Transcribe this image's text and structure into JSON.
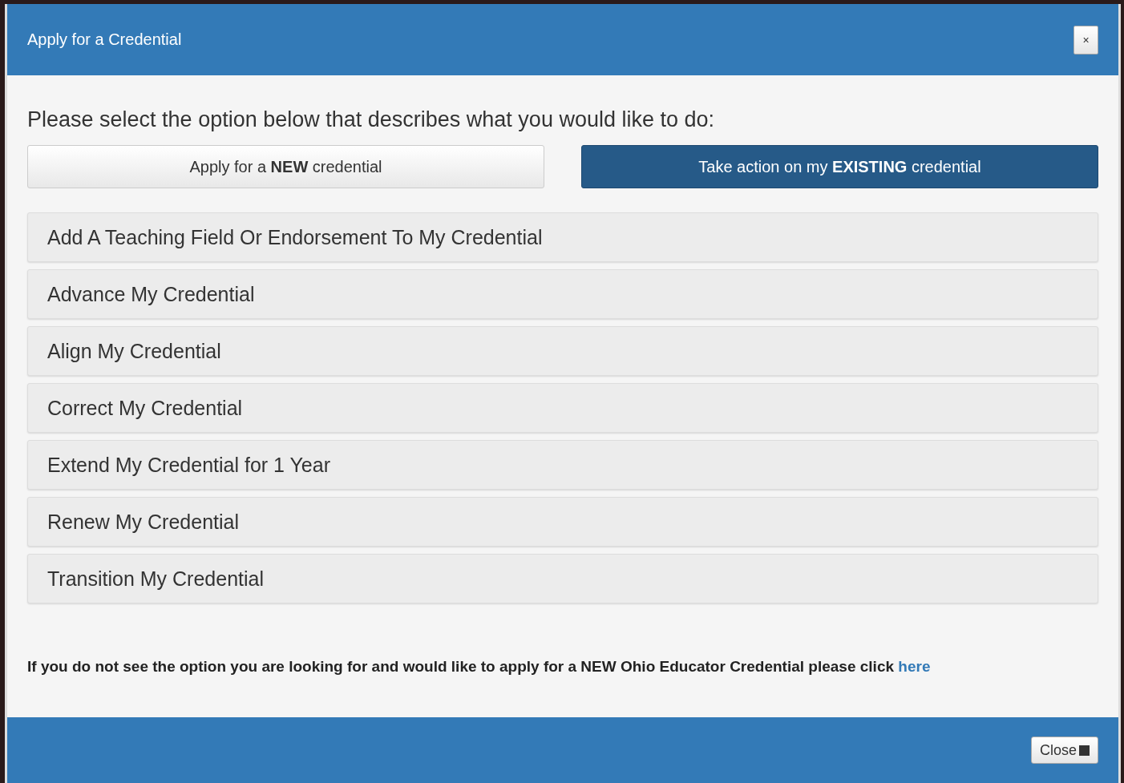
{
  "dialog": {
    "title": "Apply for a Credential",
    "close_symbol": "×"
  },
  "prompt": "Please select the option below that describes what you would like to do:",
  "choices": [
    {
      "label": "Apply for a **NEW** credential",
      "selected": false
    },
    {
      "label": "Take action on my **EXISTING** credential",
      "selected": true
    }
  ],
  "options": [
    "Add A Teaching Field Or Endorsement To My Credential",
    "Advance My Credential",
    "Align My Credential",
    "Correct My Credential",
    "Extend My Credential for 1 Year",
    "Renew My Credential",
    "Transition My Credential"
  ],
  "note": {
    "text": "If you do not see the option you are looking for and would like to apply for a NEW Ohio Educator Credential please click",
    "link": "here"
  },
  "footer": {
    "close_button": "Close"
  }
}
